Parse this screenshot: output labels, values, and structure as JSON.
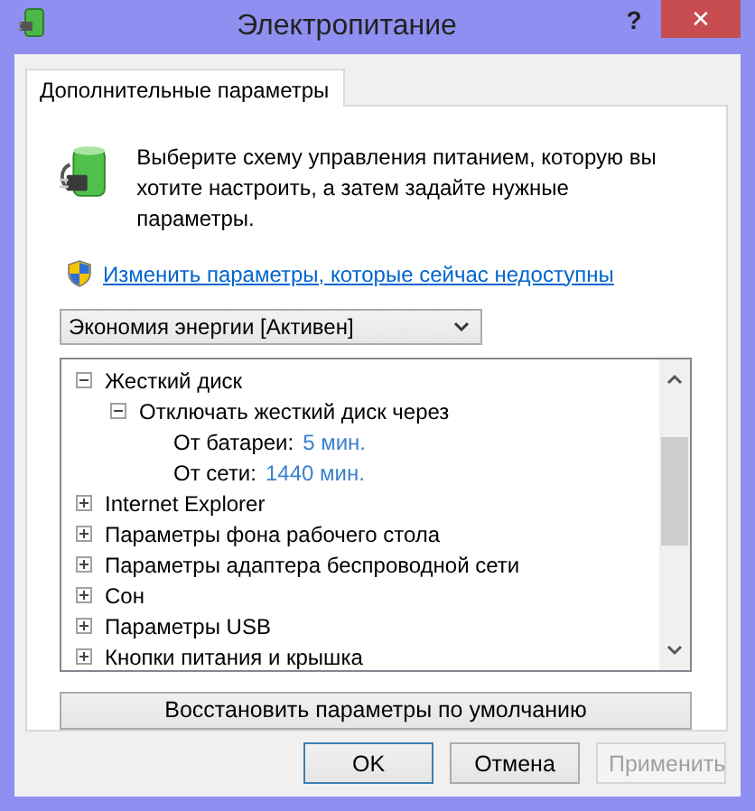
{
  "window": {
    "title": "Электропитание",
    "buttons": [
      "?",
      "✕"
    ]
  },
  "tabs": [
    {
      "label": "Дополнительные параметры",
      "selected": true
    }
  ],
  "intro": "Выберите схему управления питанием, которую вы хотите настроить, а затем задайте нужные параметры.",
  "link": "Изменить параметры, которые сейчас недоступны",
  "plan_select": {
    "value": "Экономия энергии [Активен]"
  },
  "tree": [
    {
      "label": "Жесткий диск",
      "expanded": true,
      "children": [
        {
          "label": "Отключать жесткий диск через",
          "expanded": true,
          "children": [
            {
              "label": "От батареи:",
              "value": "5 мин."
            },
            {
              "label": "От сети:",
              "value": "1440 мин."
            }
          ]
        }
      ]
    },
    {
      "label": "Internet Explorer",
      "expanded": false
    },
    {
      "label": "Параметры фона рабочего стола",
      "expanded": false
    },
    {
      "label": "Параметры адаптера беспроводной сети",
      "expanded": false
    },
    {
      "label": "Сон",
      "expanded": false
    },
    {
      "label": "Параметры USB",
      "expanded": false
    },
    {
      "label": "Кнопки питания и крышка",
      "expanded": false
    }
  ],
  "restore_button": "Восстановить параметры по умолчанию",
  "buttons": [
    {
      "label": "OK",
      "disabled": false,
      "default": true
    },
    {
      "label": "Отмена",
      "disabled": false,
      "default": false
    },
    {
      "label": "Применить",
      "disabled": true,
      "default": false
    }
  ]
}
